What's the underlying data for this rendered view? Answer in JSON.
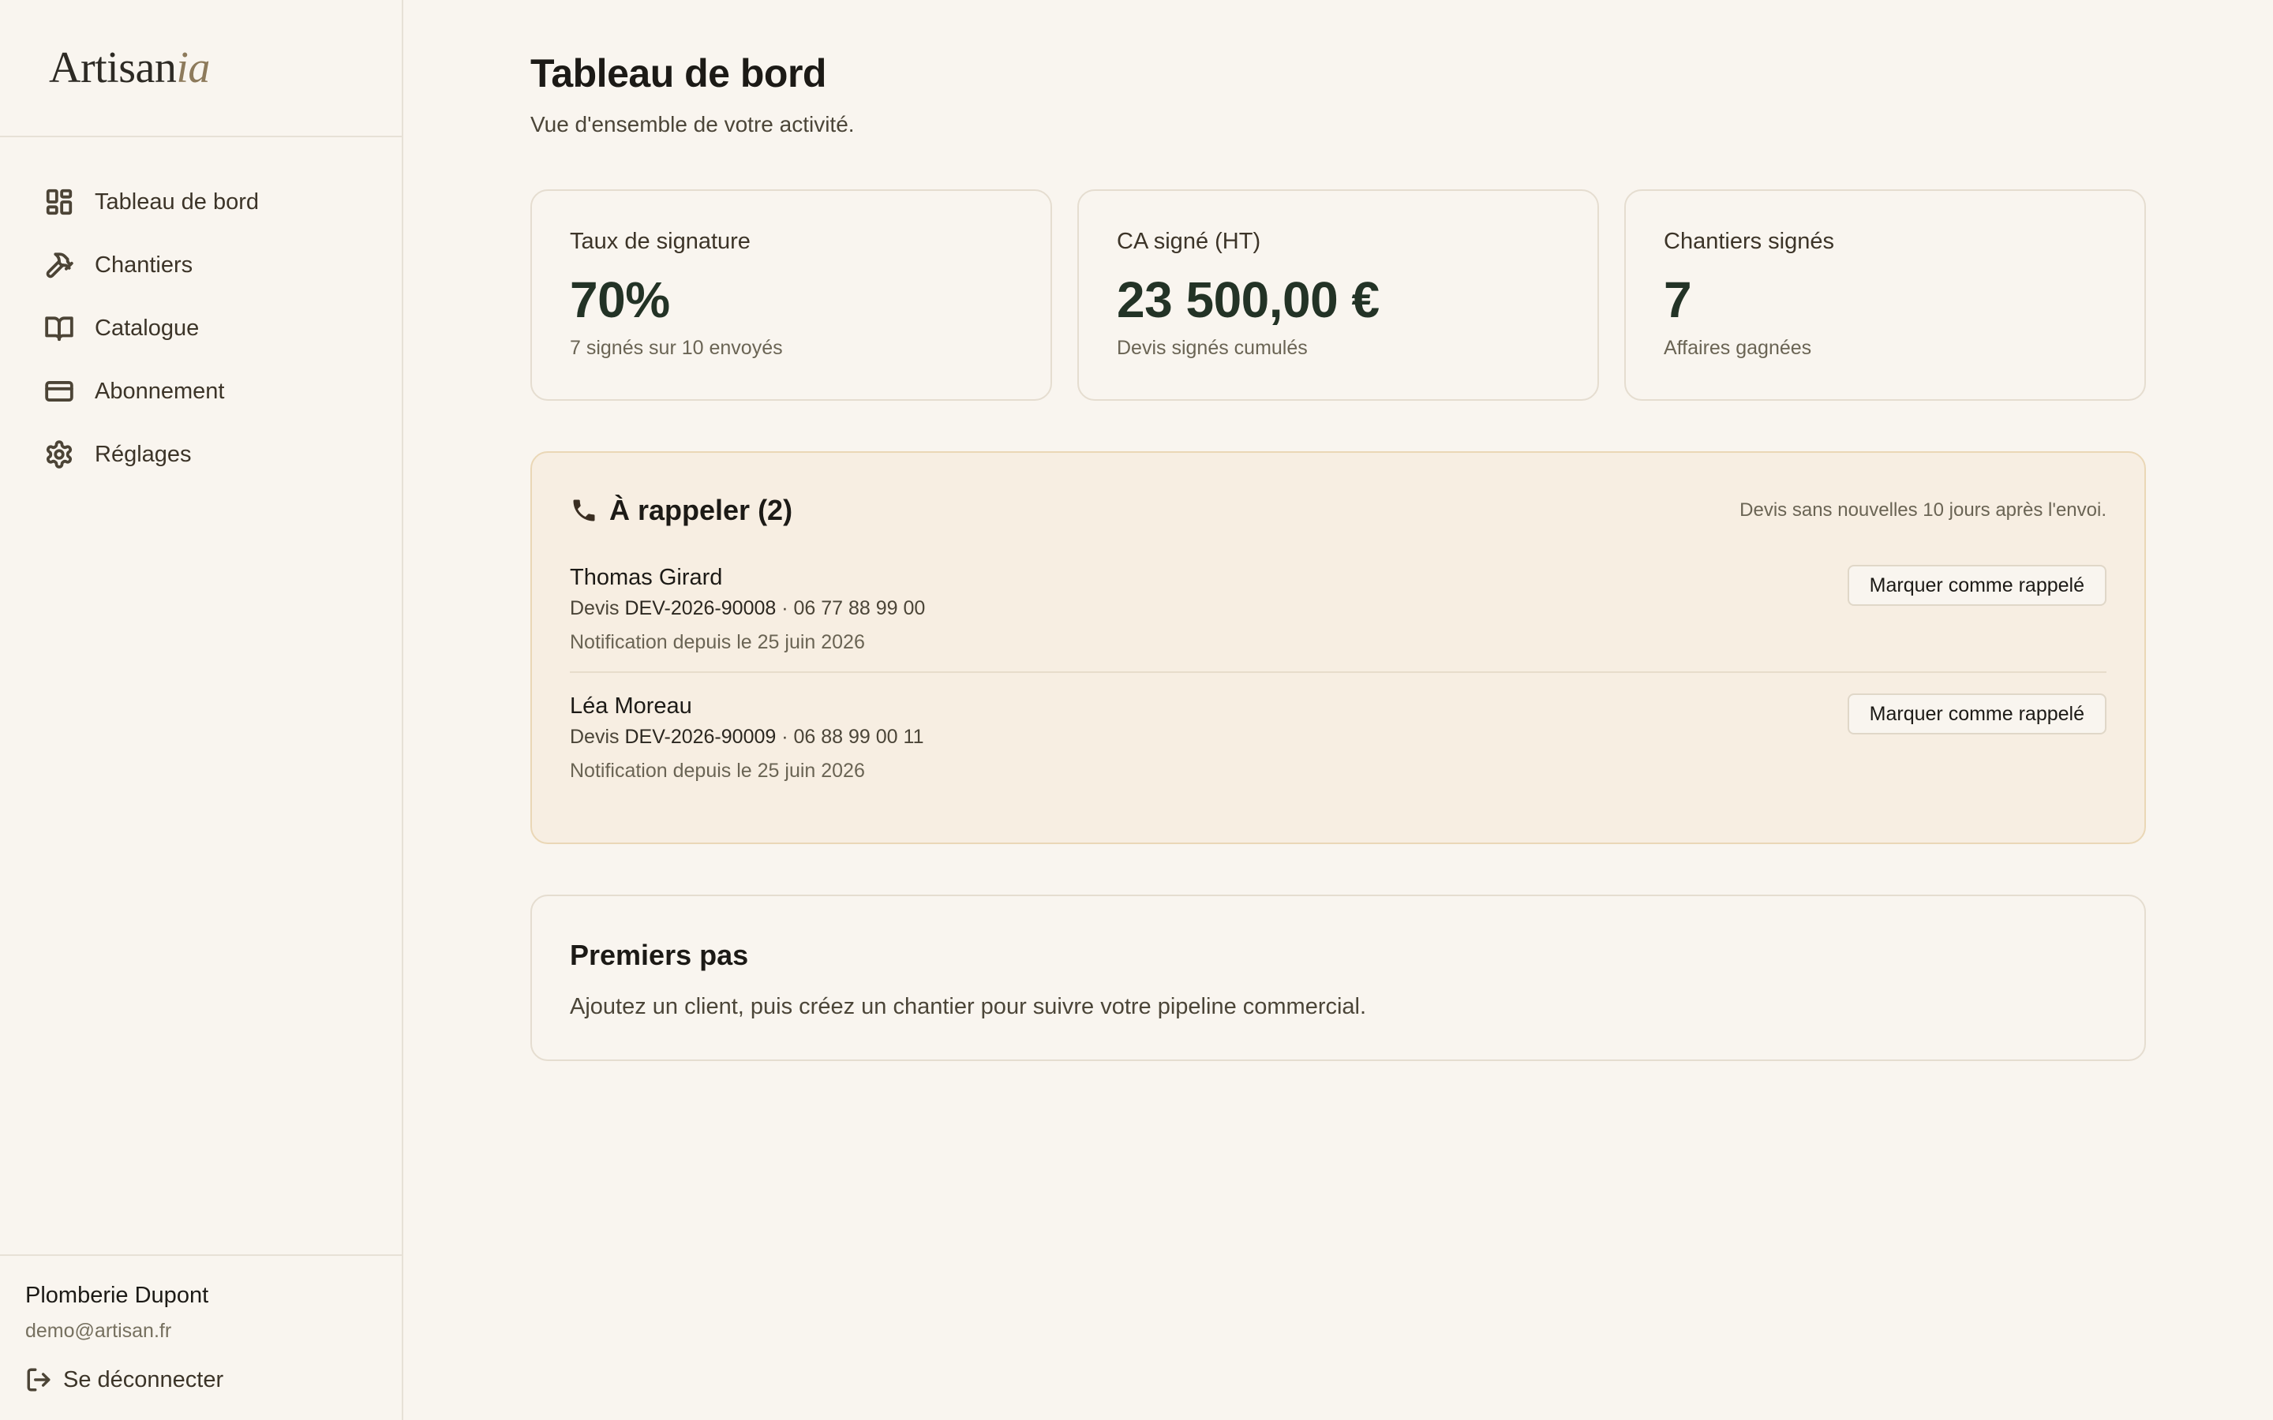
{
  "brand": {
    "name_main": "Artisan",
    "name_accent": "ia"
  },
  "sidebar": {
    "items": [
      {
        "label": "Tableau de bord",
        "icon": "dashboard-icon"
      },
      {
        "label": "Chantiers",
        "icon": "hammer-icon"
      },
      {
        "label": "Catalogue",
        "icon": "book-icon"
      },
      {
        "label": "Abonnement",
        "icon": "credit-card-icon"
      },
      {
        "label": "Réglages",
        "icon": "gear-icon"
      }
    ],
    "footer": {
      "company": "Plomberie Dupont",
      "email": "demo@artisan.fr",
      "logout_label": "Se déconnecter"
    }
  },
  "header": {
    "title": "Tableau de bord",
    "subtitle": "Vue d'ensemble de votre activité."
  },
  "stats": [
    {
      "label": "Taux de signature",
      "value": "70%",
      "sub": "7 signés sur 10 envoyés"
    },
    {
      "label": "CA signé (HT)",
      "value": "23 500,00 €",
      "sub": "Devis signés cumulés"
    },
    {
      "label": "Chantiers signés",
      "value": "7",
      "sub": "Affaires gagnées"
    }
  ],
  "callbacks": {
    "title": "À rappeler (2)",
    "note": "Devis sans nouvelles 10 jours après l'envoi.",
    "button_label": "Marquer comme rappelé",
    "items": [
      {
        "name": "Thomas Girard",
        "prefix": "Devis",
        "ref": "DEV-2026-90008",
        "phone": "· 06 77 88 99 00",
        "since": "Notification depuis le 25 juin 2026"
      },
      {
        "name": "Léa Moreau",
        "prefix": "Devis",
        "ref": "DEV-2026-90009",
        "phone": "· 06 88 99 00 11",
        "since": "Notification depuis le 25 juin 2026"
      }
    ]
  },
  "getting_started": {
    "title": "Premiers pas",
    "text": "Ajoutez un client, puis créez un chantier pour suivre votre pipeline commercial."
  },
  "colors": {
    "background": "#f9f5ef",
    "accent_dark_green": "#233326",
    "callback_bg": "#f7eee2",
    "brand_accent": "#8d7a5b"
  }
}
